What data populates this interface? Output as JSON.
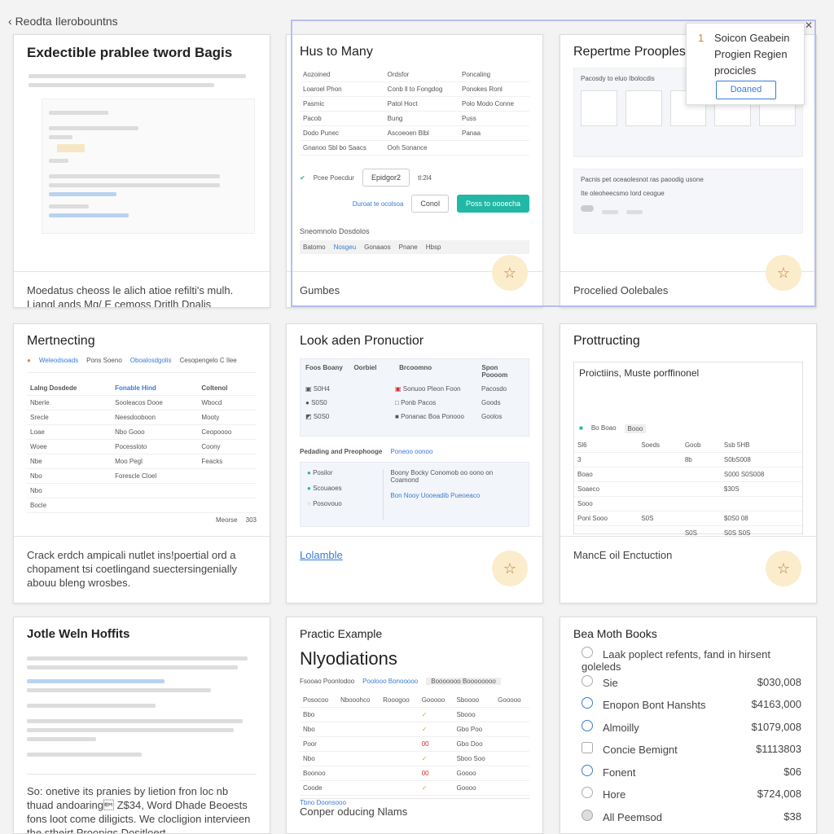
{
  "breadcrumb": "Reodta Ilerobountns",
  "colors": {
    "accent": "#21b8a5",
    "star_bg": "#fbeccb",
    "selection": "#b7bdf0",
    "link": "#3a7bd5"
  },
  "popup": {
    "number": "1",
    "text": "Soicon Geabein Progien Regien procicles",
    "button": "Doaned"
  },
  "cards": [
    {
      "title": "Exdectible prablee tword Bagis",
      "footer": "Moedatus cheoss le alich atioe refilti's mulh. Liangl ands Mg/ E cemoss Dritlh Dnalis soragaled Feiars."
    },
    {
      "title": "Hus to Many",
      "footer": "Gumbes",
      "thumb": {
        "cols": [
          "Aozoined",
          "Ordsfor",
          "Poncaling"
        ],
        "rows": [
          [
            "Loaroel Phon",
            "Conb ll to Fongdog",
            "Ponokes Ronl"
          ],
          [
            "Pasmic",
            "Patol Hoct",
            "Polo Modo Conne"
          ],
          [
            "Pacob",
            "Bung",
            "Puss"
          ],
          [
            "Dodo Punec",
            "Ascoeoen Blbl",
            "Panaa"
          ],
          [
            "Gnanoo Sbl bo Saacs",
            "Ooh Sonance",
            ""
          ]
        ],
        "check_label": "Pcee Poecdur",
        "pill": "Epidgor2",
        "pill_value": "tl:2l4",
        "link": "Duroat te ocolsoa",
        "cancel": "Conol",
        "confirm": "Poss to oooecha",
        "section": "Sneomnolo Dosdolos",
        "tabs": [
          "Batomo",
          "Nosgeu",
          "Gonaaos",
          "Pnane",
          "Hbsp"
        ]
      }
    },
    {
      "title": "Repertme Prooples",
      "footer": "Procelied Oolebales",
      "thumb": {
        "heading": "Pacosdy to eluo Ibolocdis",
        "section": "Pacnis pet oceaolesnot ras paoodig usone",
        "sub": "Ite oleoheecsmo lord ceogue"
      }
    },
    {
      "title": "Mertnecting",
      "footer": "Crack erdch ampicali nutlet ins!poertial ord a chopament tsi coetlingand suectersingenially abouu bleng wrosbes.",
      "thumb": {
        "top": [
          "Weleodsoads",
          "Pons Soeno",
          "Oboalosdgolis",
          "Cesopengelo C Ilee"
        ],
        "cols": [
          "Lalng Dosdede",
          "Fonable Hind",
          "Coltenol"
        ],
        "rows": [
          [
            "Nberle",
            "Sooleacos Dooe",
            "Wbocd"
          ],
          [
            "Srecle",
            "Neesdooboon",
            "Mooty"
          ],
          [
            "Loae",
            "Nbo Gooo",
            "Ceopoooo"
          ],
          [
            "Woee",
            "Pocessloto",
            "Coony"
          ],
          [
            "Nbe",
            "Moo Pegl",
            "Feacks"
          ],
          [
            "Nbo",
            "Forescle Cloel",
            ""
          ],
          [
            "Nbo",
            "",
            ""
          ],
          [
            "Bocle",
            "",
            ""
          ]
        ],
        "foot_a": "Meorse",
        "foot_b": "303"
      }
    },
    {
      "title": "Look aden Pronuctior",
      "footer": "Lolamble",
      "thumb": {
        "cols": [
          "Foos Boany",
          "Oorbiel",
          "Brcoomno",
          "Spon Poooom"
        ],
        "rows": [
          [
            "S0H4",
            "Sonuoo Pleon Foon",
            "Pacosdo"
          ],
          [
            "S0S0",
            "Ponb Pacos",
            "Goods"
          ],
          [
            "S0S0",
            "Ponanac Boa Ponooo",
            "Goolos"
          ]
        ],
        "section": "Pedading and Preophooge",
        "section_link": "Poneoo oonoo",
        "items": [
          "Posilor",
          "Scouaoes",
          "Posovouo"
        ],
        "notes": [
          "Boony Bocky Conomob oo oono on Coamond",
          "Bon Nooy Uooeadib Pueoeaco"
        ]
      }
    },
    {
      "title": "Prottructing",
      "footer": "MancE oil Enctuction",
      "thumb": {
        "heading": "Proictiins, Muste porffinonel",
        "chip_a": "Bo Boao",
        "chip_b": "Booo",
        "rows": [
          [
            "Sl6",
            "Soeds",
            "Goob",
            "Ssb 5HB"
          ],
          [
            "3",
            "",
            "8b",
            "S0bS008"
          ],
          [
            "Boao",
            "",
            "",
            "S000 S0S008"
          ],
          [
            "Soaeco",
            "",
            "",
            "$30S"
          ],
          [
            "Sooo",
            "",
            "",
            ""
          ],
          [
            "Ponl Sooo",
            "S0S",
            "",
            "$0S0 08"
          ],
          [
            "",
            "",
            "S0S",
            "S0S S0S"
          ]
        ]
      }
    },
    {
      "title": "Jotle Weln Hoffits",
      "footer": "So: onetive its pranies by lietion fron loc nb thuad andoaring\u0019 Z$34, Word Dhade Beoests fons loot come diligicts. We clocligion intervieen the stheirt Proopigs Dositloert."
    },
    {
      "title": "Practic Example",
      "subtitle": "Nlyodiations",
      "footer": "Conper oducing Nlams",
      "thumb": {
        "tabs": [
          "Fsooao Poonlodoo",
          "Poolooo Bonooooo",
          "Booooooo Boooooooo"
        ],
        "cols": [
          "Posocoo",
          "Nbooohco",
          "Rooogoo",
          "Gooooo",
          "Sboooo",
          "Gooooo"
        ],
        "rows": [
          [
            "Bbo",
            "",
            "",
            "",
            "Sbooo",
            ""
          ],
          [
            "Nbo",
            "",
            "",
            "",
            "Gbo Poo",
            ""
          ],
          [
            "Poor",
            "",
            "",
            "00",
            "Gbo Doo",
            ""
          ],
          [
            "Nbo",
            "",
            "",
            "",
            "Sboo Soo",
            ""
          ],
          [
            "Boonoo",
            "",
            "",
            "00",
            "Goooo",
            ""
          ],
          [
            "Coode",
            "",
            "",
            "",
            "Goooo",
            ""
          ]
        ],
        "link": "Tbno Doonsooo"
      }
    },
    {
      "title": "Bea Moth Books",
      "list": [
        {
          "label": "Laak poplect refents, fand in hirsent goleleds",
          "value": ""
        },
        {
          "label": "Sie",
          "value": "$030,008"
        },
        {
          "label": "Enopon Bont Hanshts",
          "value": "$4163,000"
        },
        {
          "label": "Almoilly",
          "value": "$1079,008"
        },
        {
          "label": "Concie Bemignt",
          "value": "$1113803"
        },
        {
          "label": "Fonent",
          "value": "$06"
        },
        {
          "label": "Hore",
          "value": "$724,008"
        },
        {
          "label": "All Peemsod",
          "value": "$38"
        }
      ]
    }
  ]
}
